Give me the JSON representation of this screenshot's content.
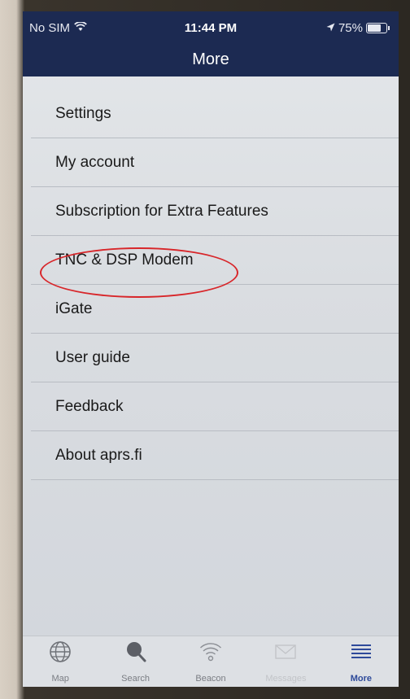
{
  "status_bar": {
    "carrier": "No SIM",
    "time": "11:44 PM",
    "battery": "75%"
  },
  "nav": {
    "title": "More"
  },
  "menu": {
    "items": [
      {
        "label": "Settings"
      },
      {
        "label": "My account"
      },
      {
        "label": "Subscription for Extra Features"
      },
      {
        "label": "TNC & DSP Modem"
      },
      {
        "label": "iGate"
      },
      {
        "label": "User guide"
      },
      {
        "label": "Feedback"
      },
      {
        "label": "About aprs.fi"
      }
    ]
  },
  "tab_bar": {
    "tabs": [
      {
        "label": "Map",
        "icon": "globe-icon"
      },
      {
        "label": "Search",
        "icon": "search-icon"
      },
      {
        "label": "Beacon",
        "icon": "wifi-icon"
      },
      {
        "label": "Messages",
        "icon": "envelope-icon"
      },
      {
        "label": "More",
        "icon": "menu-icon"
      }
    ]
  },
  "colors": {
    "nav_bg": "#1c2a52",
    "highlight": "#d8262a",
    "tab_active": "#2e4a9a"
  }
}
